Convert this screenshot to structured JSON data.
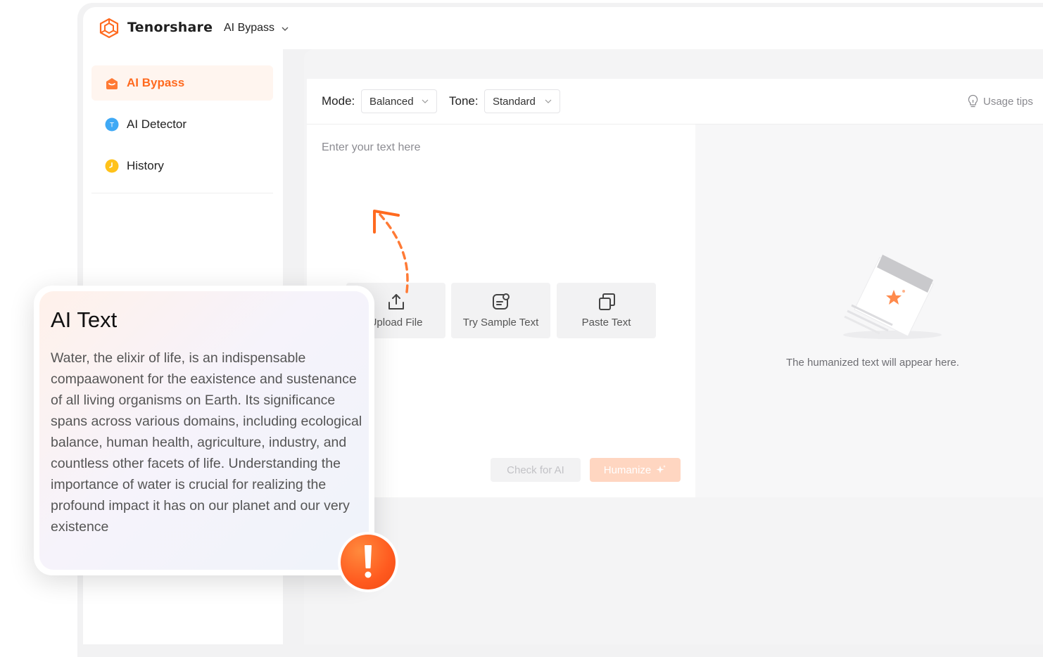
{
  "header": {
    "brand": "Tenorshare",
    "product": "AI Bypass"
  },
  "sidebar": {
    "items": [
      {
        "label": "AI Bypass",
        "icon": "bypass-icon",
        "active": true
      },
      {
        "label": "AI Detector",
        "icon": "detector-icon",
        "active": false
      },
      {
        "label": "History",
        "icon": "clock-icon",
        "active": false
      }
    ]
  },
  "toolbar": {
    "mode_label": "Mode:",
    "mode_value": "Balanced",
    "tone_label": "Tone:",
    "tone_value": "Standard",
    "usage_tips": "Usage tips"
  },
  "editor": {
    "placeholder": "Enter your text here",
    "actions": [
      {
        "label": "Upload File",
        "icon": "upload-icon"
      },
      {
        "label": "Try Sample Text",
        "icon": "sample-text-icon"
      },
      {
        "label": "Paste Text",
        "icon": "paste-icon"
      }
    ],
    "check_label": "Check for AI",
    "humanize_label": "Humanize"
  },
  "output": {
    "empty_text": "The humanized text will appear here."
  },
  "card": {
    "title": "AI Text",
    "body": "Water, the elixir of life, is an indispensable compaawonent for the eaxistence and sustenance of all living organisms on Earth. Its significance spans across various domains, including ecological balance, human health, agriculture, industry, and countless other facets of life. Understanding the importance of water is crucial for realizing the profound impact it has on our planet and our very existence"
  },
  "colors": {
    "accent": "#ff6a1f",
    "accent_light": "#ffd6c1",
    "active_bg": "#fff5ef"
  }
}
